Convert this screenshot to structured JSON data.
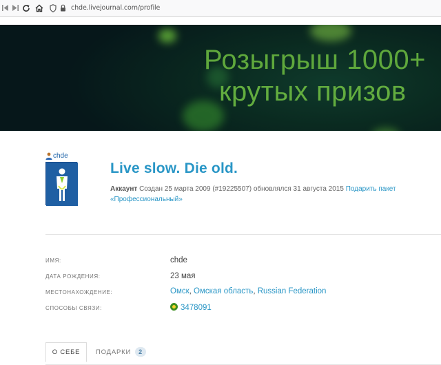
{
  "browser": {
    "url": "chde.livejournal.com/profile",
    "icons": [
      "first-page-icon",
      "last-page-icon",
      "reload-icon",
      "home-icon",
      "shield-icon",
      "lock-icon"
    ]
  },
  "banner": {
    "line1": "Розыгрыш 1000+",
    "line2": "крутых призов"
  },
  "profile": {
    "username": "chde",
    "journal_title": "Live slow. Die old.",
    "account_label": "Аккаунт",
    "account_text": " Создан 25 марта 2009 (#19225507) обновлялся 31 августа 2015 ",
    "upgrade_link": "Подарить пакет «Профессиональный»"
  },
  "info": {
    "name_label": "ИМЯ:",
    "name_value": "chde",
    "birthday_label": "ДАТА РОЖДЕНИЯ:",
    "birthday_value": "23 мая",
    "location_label": "МЕСТОНАХОЖДЕНИЕ:",
    "location_city": "Омск",
    "location_region": "Омская область",
    "location_country": "Russian Federation",
    "contacts_label": "СПОСОБЫ СВЯЗИ:",
    "icq_number": "3478091"
  },
  "tabs": {
    "about": "О СЕБЕ",
    "gifts": "ПОДАРКИ",
    "gifts_count": "2"
  },
  "colors": {
    "link": "#2996c6",
    "banner_bg": "#0a2a20",
    "banner_text": "#5fa83c",
    "userpic_bg": "#1f5fa3"
  }
}
